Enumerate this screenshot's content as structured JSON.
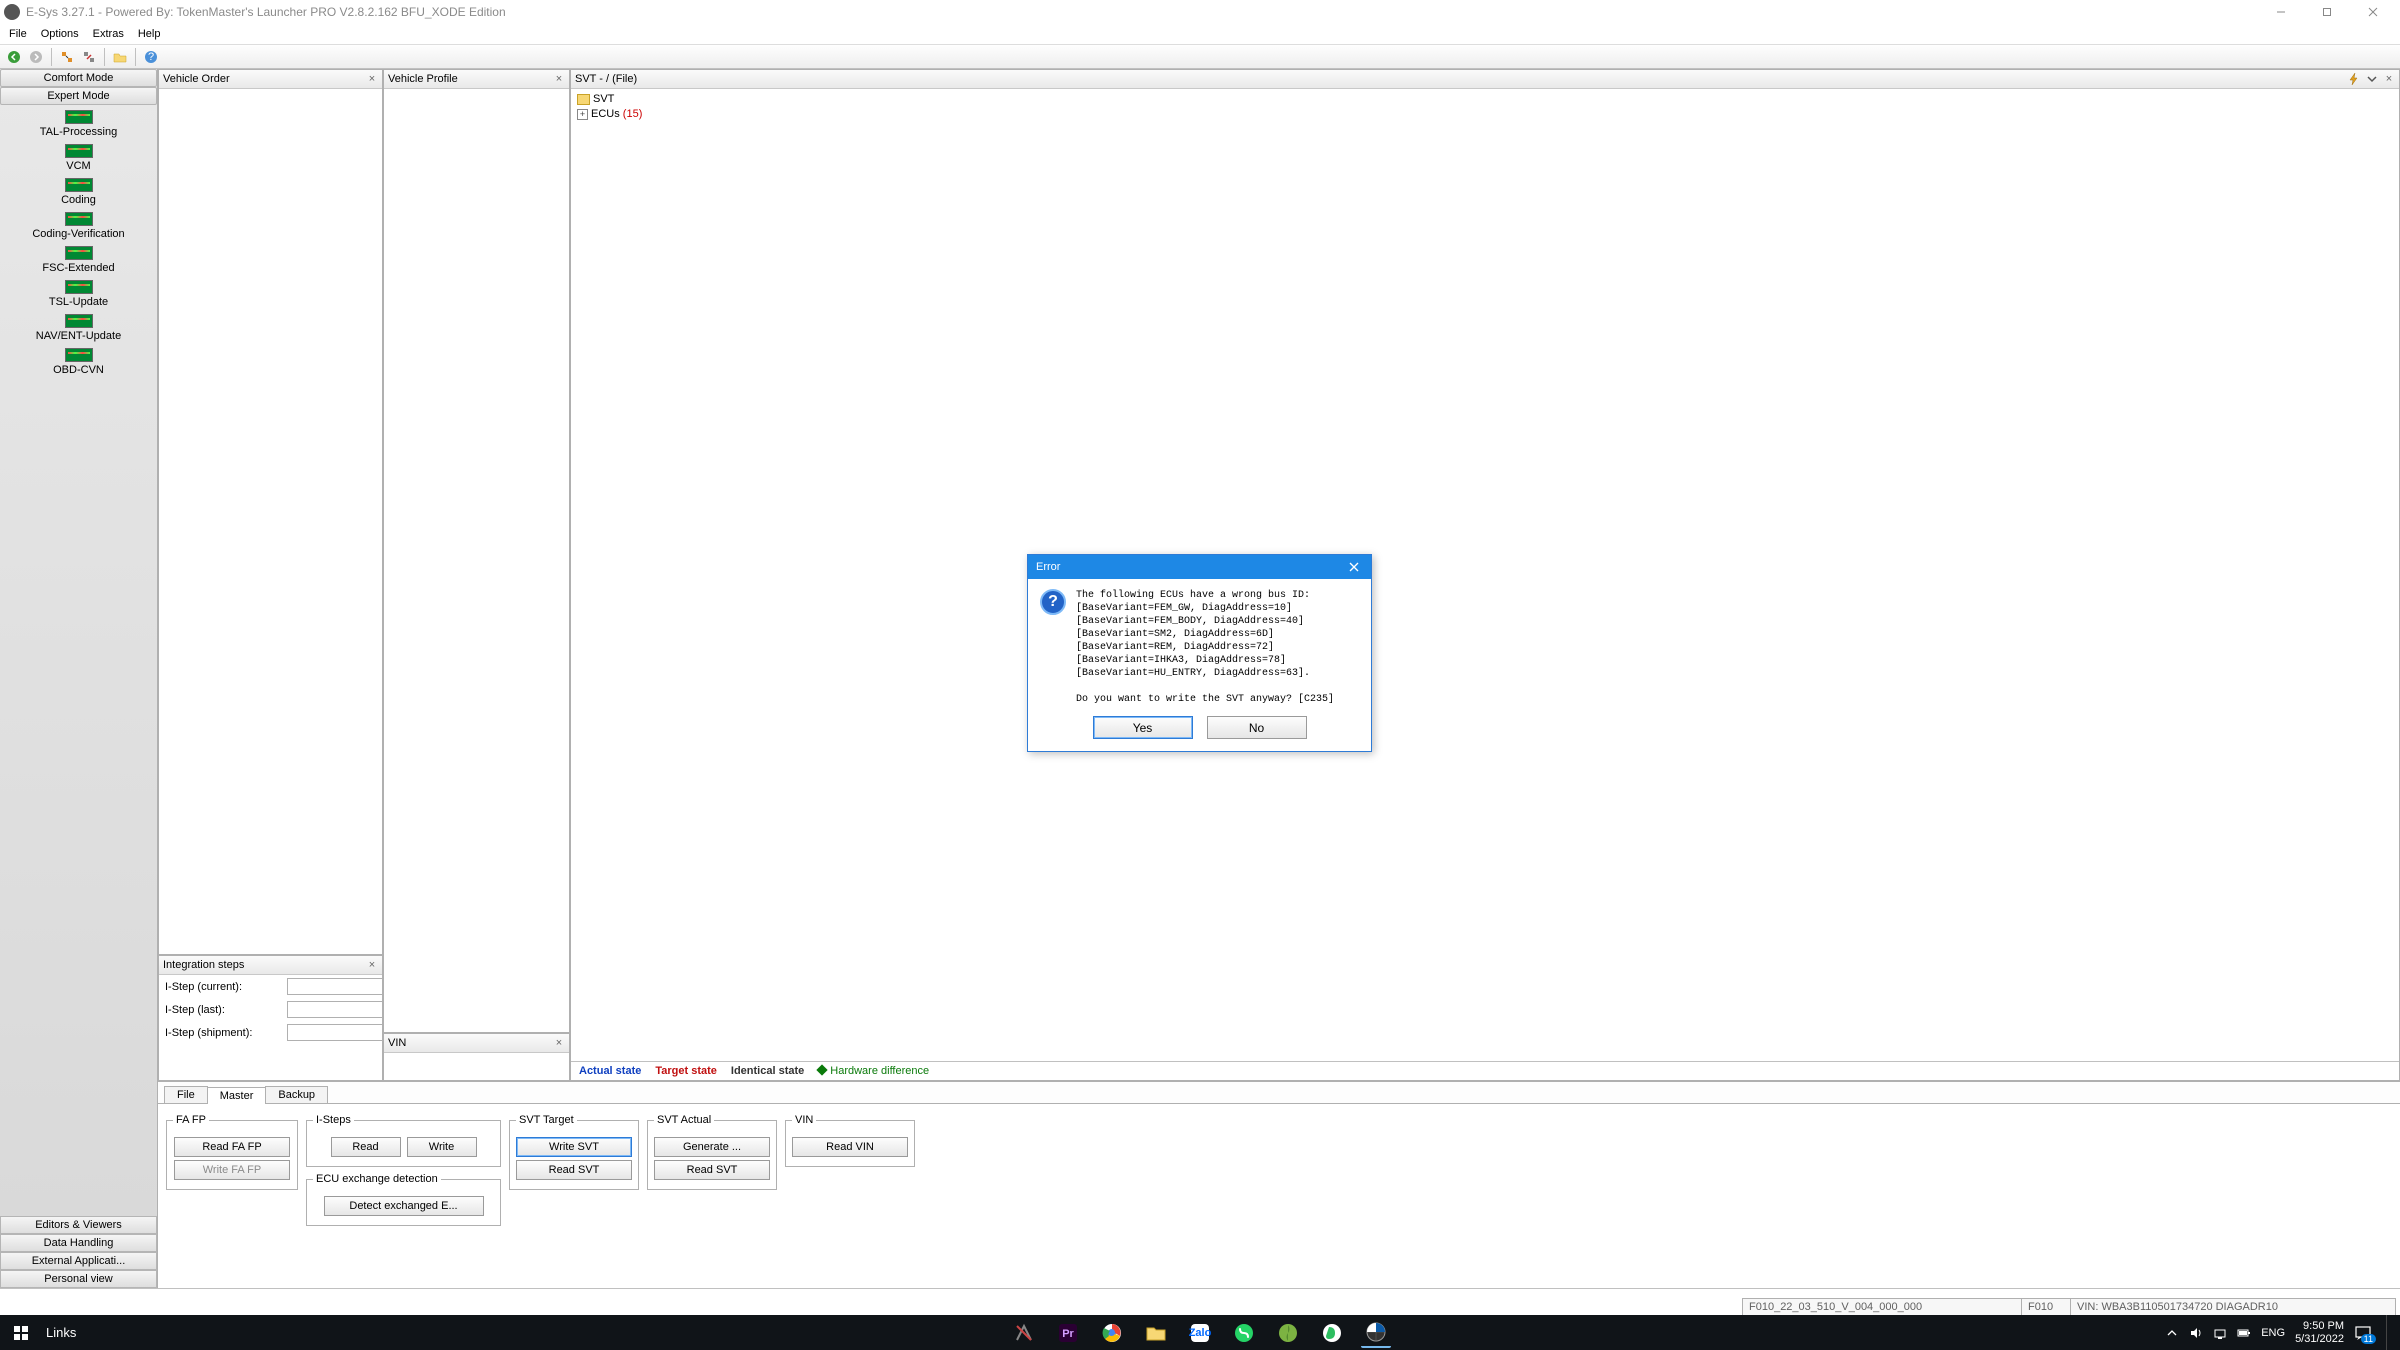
{
  "titlebar": {
    "text": "E-Sys 3.27.1 - Powered By: TokenMaster's Launcher PRO V2.8.2.162 BFU_XODE Edition"
  },
  "menubar": [
    "File",
    "Options",
    "Extras",
    "Help"
  ],
  "sidebar": {
    "top_buttons": [
      "Comfort Mode",
      "Expert Mode"
    ],
    "nav_items": [
      "TAL-Processing",
      "VCM",
      "Coding",
      "Coding-Verification",
      "FSC-Extended",
      "TSL-Update",
      "NAV/ENT-Update",
      "OBD-CVN"
    ],
    "bottom_buttons": [
      "Editors & Viewers",
      "Data Handling",
      "External Applicati...",
      "Personal view"
    ]
  },
  "panels": {
    "vehicle_order": {
      "title": "Vehicle Order"
    },
    "integration_steps": {
      "title": "Integration steps",
      "rows": {
        "current_label": "I-Step (current):",
        "last_label": "I-Step (last):",
        "shipment_label": "I-Step (shipment):"
      }
    },
    "vehicle_profile": {
      "title": "Vehicle Profile"
    },
    "vin": {
      "title": "VIN"
    },
    "svt": {
      "title": "SVT - / (File)",
      "tree": {
        "root": "SVT",
        "child_label": "ECUs",
        "child_count": "(15)"
      },
      "legend": {
        "actual": "Actual state",
        "target": "Target state",
        "identical": "Identical state",
        "hw": "Hardware difference"
      }
    }
  },
  "bottom_tabs": [
    "File",
    "Master",
    "Backup"
  ],
  "groups": {
    "fa_fp": {
      "legend": "FA FP",
      "read": "Read FA FP",
      "write": "Write FA FP"
    },
    "isteps": {
      "legend": "I-Steps",
      "read": "Read",
      "write": "Write"
    },
    "ecu_ex": {
      "legend": "ECU exchange detection",
      "btn": "Detect exchanged E..."
    },
    "svt_target": {
      "legend": "SVT Target",
      "write": "Write SVT",
      "read": "Read SVT"
    },
    "svt_actual": {
      "legend": "SVT Actual",
      "gen": "Generate ...",
      "read": "Read SVT"
    },
    "vin": {
      "legend": "VIN",
      "read": "Read VIN"
    }
  },
  "statusbar": {
    "cells": [
      "F010_22_03_510_V_004_000_000",
      "F010",
      "VIN: WBA3B110501734720  DIAGADR10"
    ]
  },
  "dialog": {
    "title": "Error",
    "message": "The following ECUs have a wrong bus ID:\n[BaseVariant=FEM_GW, DiagAddress=10]\n[BaseVariant=FEM_BODY, DiagAddress=40]\n[BaseVariant=SM2, DiagAddress=6D]\n[BaseVariant=REM, DiagAddress=72]\n[BaseVariant=IHKA3, DiagAddress=78]\n[BaseVariant=HU_ENTRY, DiagAddress=63].\n\nDo you want to write the SVT anyway? [C235]",
    "yes": "Yes",
    "no": "No"
  },
  "taskbar": {
    "links": "Links",
    "lang": "ENG",
    "time": "9:50 PM",
    "date": "5/31/2022",
    "notif_count": "11"
  }
}
